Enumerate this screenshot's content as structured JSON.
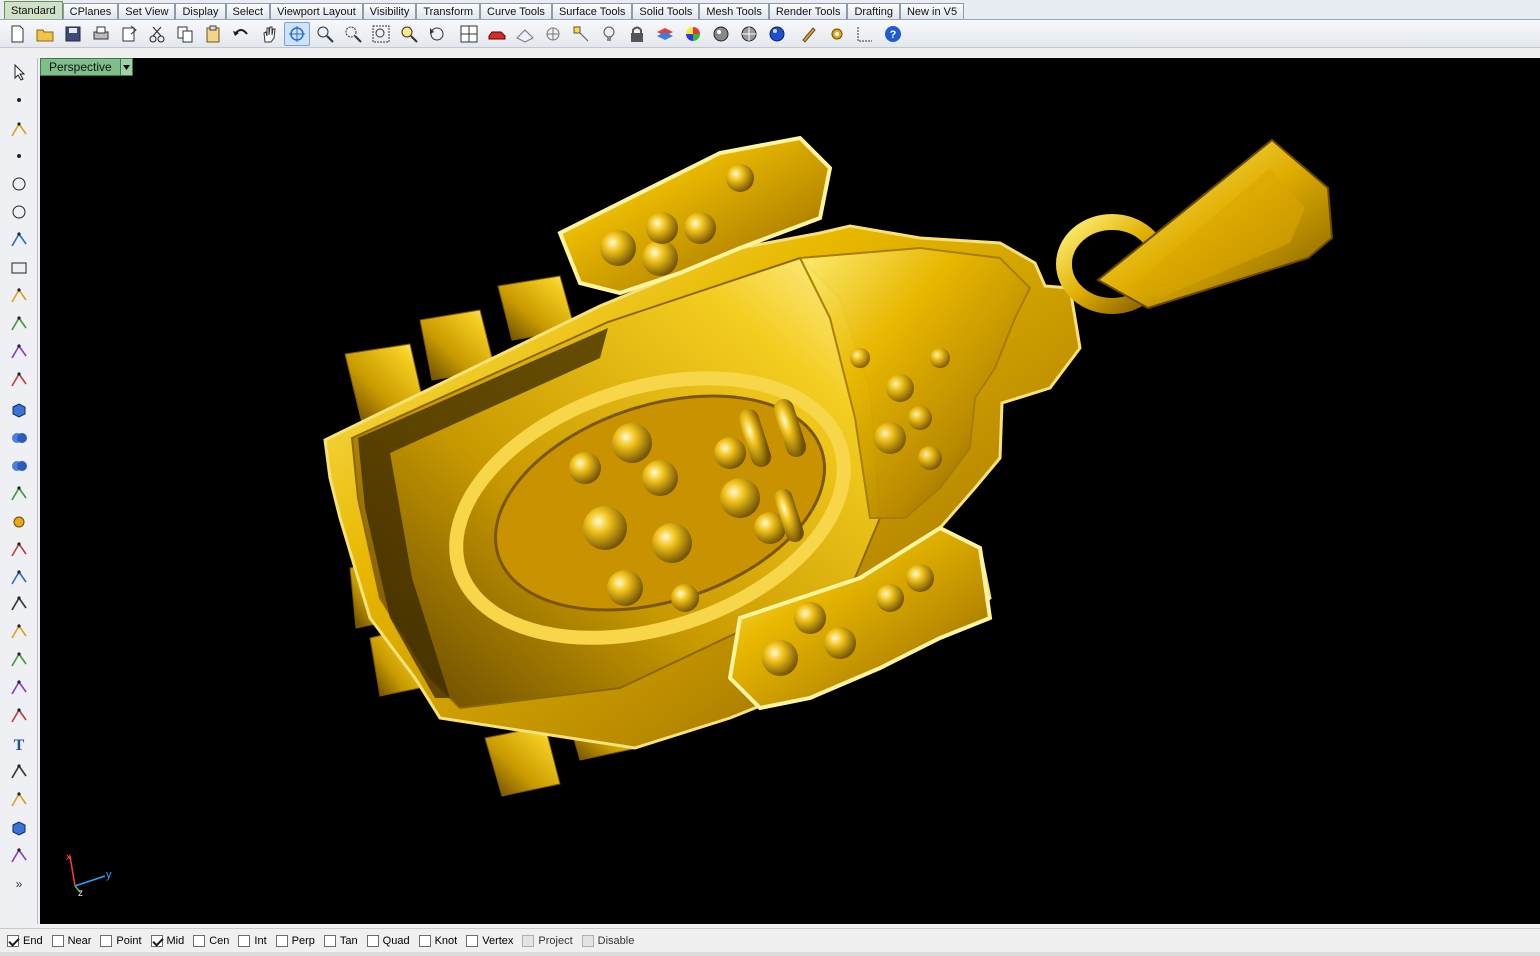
{
  "tabs": [
    {
      "label": "Standard",
      "active": true
    },
    {
      "label": "CPlanes"
    },
    {
      "label": "Set View"
    },
    {
      "label": "Display"
    },
    {
      "label": "Select"
    },
    {
      "label": "Viewport Layout"
    },
    {
      "label": "Visibility"
    },
    {
      "label": "Transform"
    },
    {
      "label": "Curve Tools"
    },
    {
      "label": "Surface Tools"
    },
    {
      "label": "Solid Tools"
    },
    {
      "label": "Mesh Tools"
    },
    {
      "label": "Render Tools"
    },
    {
      "label": "Drafting"
    },
    {
      "label": "New in V5"
    }
  ],
  "toolbar_icons": [
    "new-file-icon",
    "open-folder-icon",
    "save-icon",
    "print-icon",
    "import-icon",
    "cut-icon",
    "copy-icon",
    "paste-icon",
    "undo-icon",
    "pan-hand-icon",
    "rotate-view-icon",
    "zoom-dynamic-icon",
    "zoom-window-icon",
    "zoom-extents-icon",
    "zoom-selected-icon",
    "undo-view-icon",
    "four-viewports-icon",
    "car-render-icon",
    "cplane-icon",
    "grid-snap-icon",
    "object-snap-icon",
    "light-bulb-icon",
    "lock-icon",
    "layer-icon",
    "color-wheel-icon",
    "shaded-sphere-icon",
    "rendered-sphere-icon",
    "blue-sphere-icon",
    "brush-icon",
    "gear-options-icon",
    "dimension-icon",
    "help-icon"
  ],
  "sidebar_icons": [
    "select-arrow-icon",
    "point-icon",
    "polyline-icon",
    "curve-points-icon",
    "circle-icon",
    "ellipse-icon",
    "polygon-icon",
    "rectangle-icon",
    "arc-icon",
    "fillet-curve-icon",
    "surface-corner-icon",
    "extrude-surface-icon",
    "box-solid-icon",
    "boolean-union-icon",
    "cylinder-icon",
    "mesh-plane-icon",
    "gear-solid-icon",
    "trim-icon",
    "split-icon",
    "explode-icon",
    "fillet-edge-icon",
    "group-icon",
    "join-icon",
    "move-icon",
    "text-icon",
    "scale-icon",
    "array-icon",
    "block-icon",
    "dimension-side-icon",
    "expand-icon"
  ],
  "viewport": {
    "label": "Perspective"
  },
  "axis": {
    "x": "x",
    "y": "y",
    "z": "z"
  },
  "osnaps": [
    {
      "label": "End",
      "checked": true
    },
    {
      "label": "Near",
      "checked": false
    },
    {
      "label": "Point",
      "checked": false
    },
    {
      "label": "Mid",
      "checked": true
    },
    {
      "label": "Cen",
      "checked": false
    },
    {
      "label": "Int",
      "checked": false
    },
    {
      "label": "Perp",
      "checked": false
    },
    {
      "label": "Tan",
      "checked": false
    },
    {
      "label": "Quad",
      "checked": false
    },
    {
      "label": "Knot",
      "checked": false
    },
    {
      "label": "Vertex",
      "checked": false
    },
    {
      "label": "Project",
      "checked": false,
      "disabled": true
    },
    {
      "label": "Disable",
      "checked": false,
      "disabled": true
    }
  ],
  "colors": {
    "model_gold": "#e8b800",
    "model_highlight": "#fff27a",
    "model_shadow": "#5a3f00",
    "viewport_bg": "#000000",
    "viewport_tab": "#7fbe8a"
  }
}
